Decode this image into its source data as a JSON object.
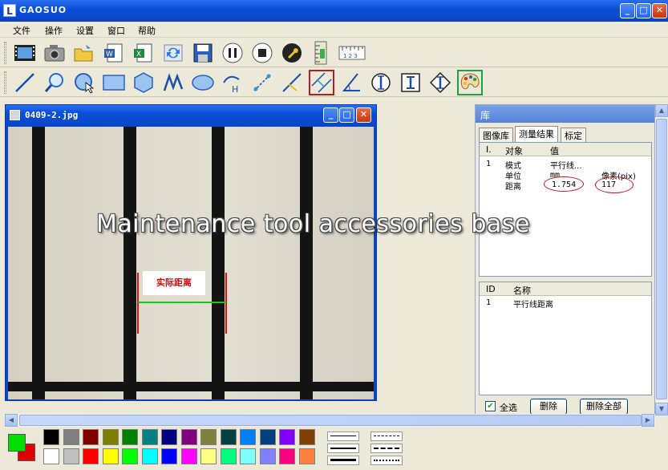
{
  "app": {
    "title": "GAOSUO",
    "icon_letter": "L"
  },
  "window_controls": {
    "minimize": "_",
    "maximize": "□",
    "close": "✕"
  },
  "menu": [
    "文件",
    "操作",
    "设置",
    "窗口",
    "帮助"
  ],
  "toolbar1_icons": [
    "film-icon",
    "camera-icon",
    "open-folder-icon",
    "word-doc-icon",
    "excel-doc-icon",
    "refresh-icon",
    "save-icon",
    "pause-icon",
    "stop-icon",
    "wrench-icon",
    "ruler-vertical-icon",
    "ruler-horizontal-icon"
  ],
  "toolbar1_ruler_text": "1 2 3",
  "toolbar2_icons": [
    "line-tool-icon",
    "magnifier-icon",
    "circle-select-icon",
    "rectangle-icon",
    "polygon-icon",
    "freehand-icon",
    "ellipse-icon",
    "arc-height-icon",
    "measure-diagonal-icon",
    "angle-line-icon",
    "parallel-lines-icon",
    "angle-icon",
    "circle-center-icon",
    "text-i-icon",
    "vertical-dimension-icon",
    "palette-icon"
  ],
  "toolbar2_arc_label": "H",
  "image_window": {
    "filename": "0409-2.jpg",
    "label": "实际距离"
  },
  "library": {
    "title": "库",
    "tabs": [
      "图像库",
      "测量结果",
      "标定"
    ],
    "active_tab": 1,
    "results_headers": [
      "I.",
      "对象",
      "值"
    ],
    "results_rows": [
      {
        "id": "1",
        "key": "模式",
        "value": "平行线...",
        "extra": ""
      },
      {
        "id": "",
        "key": "单位",
        "value": "mm",
        "extra": "像素(pix)"
      },
      {
        "id": "",
        "key": "距离",
        "value": "1.754",
        "extra": "117"
      }
    ],
    "objects_headers": [
      "ID",
      "名称"
    ],
    "objects_rows": [
      {
        "id": "1",
        "name": "平行线距离"
      }
    ],
    "select_all_label": "全选",
    "delete_label": "删除",
    "delete_all_label": "删除全部"
  },
  "scrollbar_arrows": {
    "up": "▲",
    "down": "▼",
    "left": "◀",
    "right": "▶"
  },
  "palette": {
    "primary_color": "#00e000",
    "secondary_color": "#e00000",
    "row1": [
      "#000000",
      "#808080",
      "#800000",
      "#808000",
      "#008000",
      "#008080",
      "#000080",
      "#800080",
      "#808040",
      "#004040",
      "#0080ff",
      "#004080",
      "#8000ff",
      "#804000"
    ],
    "row2": [
      "#ffffff",
      "#c0c0c0",
      "#ff0000",
      "#ffff00",
      "#00ff00",
      "#00ffff",
      "#0000ff",
      "#ff00ff",
      "#ffff80",
      "#00ff80",
      "#80ffff",
      "#8080ff",
      "#ff0080",
      "#ff8040"
    ]
  },
  "watermark": "Maintenance tool accessories base"
}
